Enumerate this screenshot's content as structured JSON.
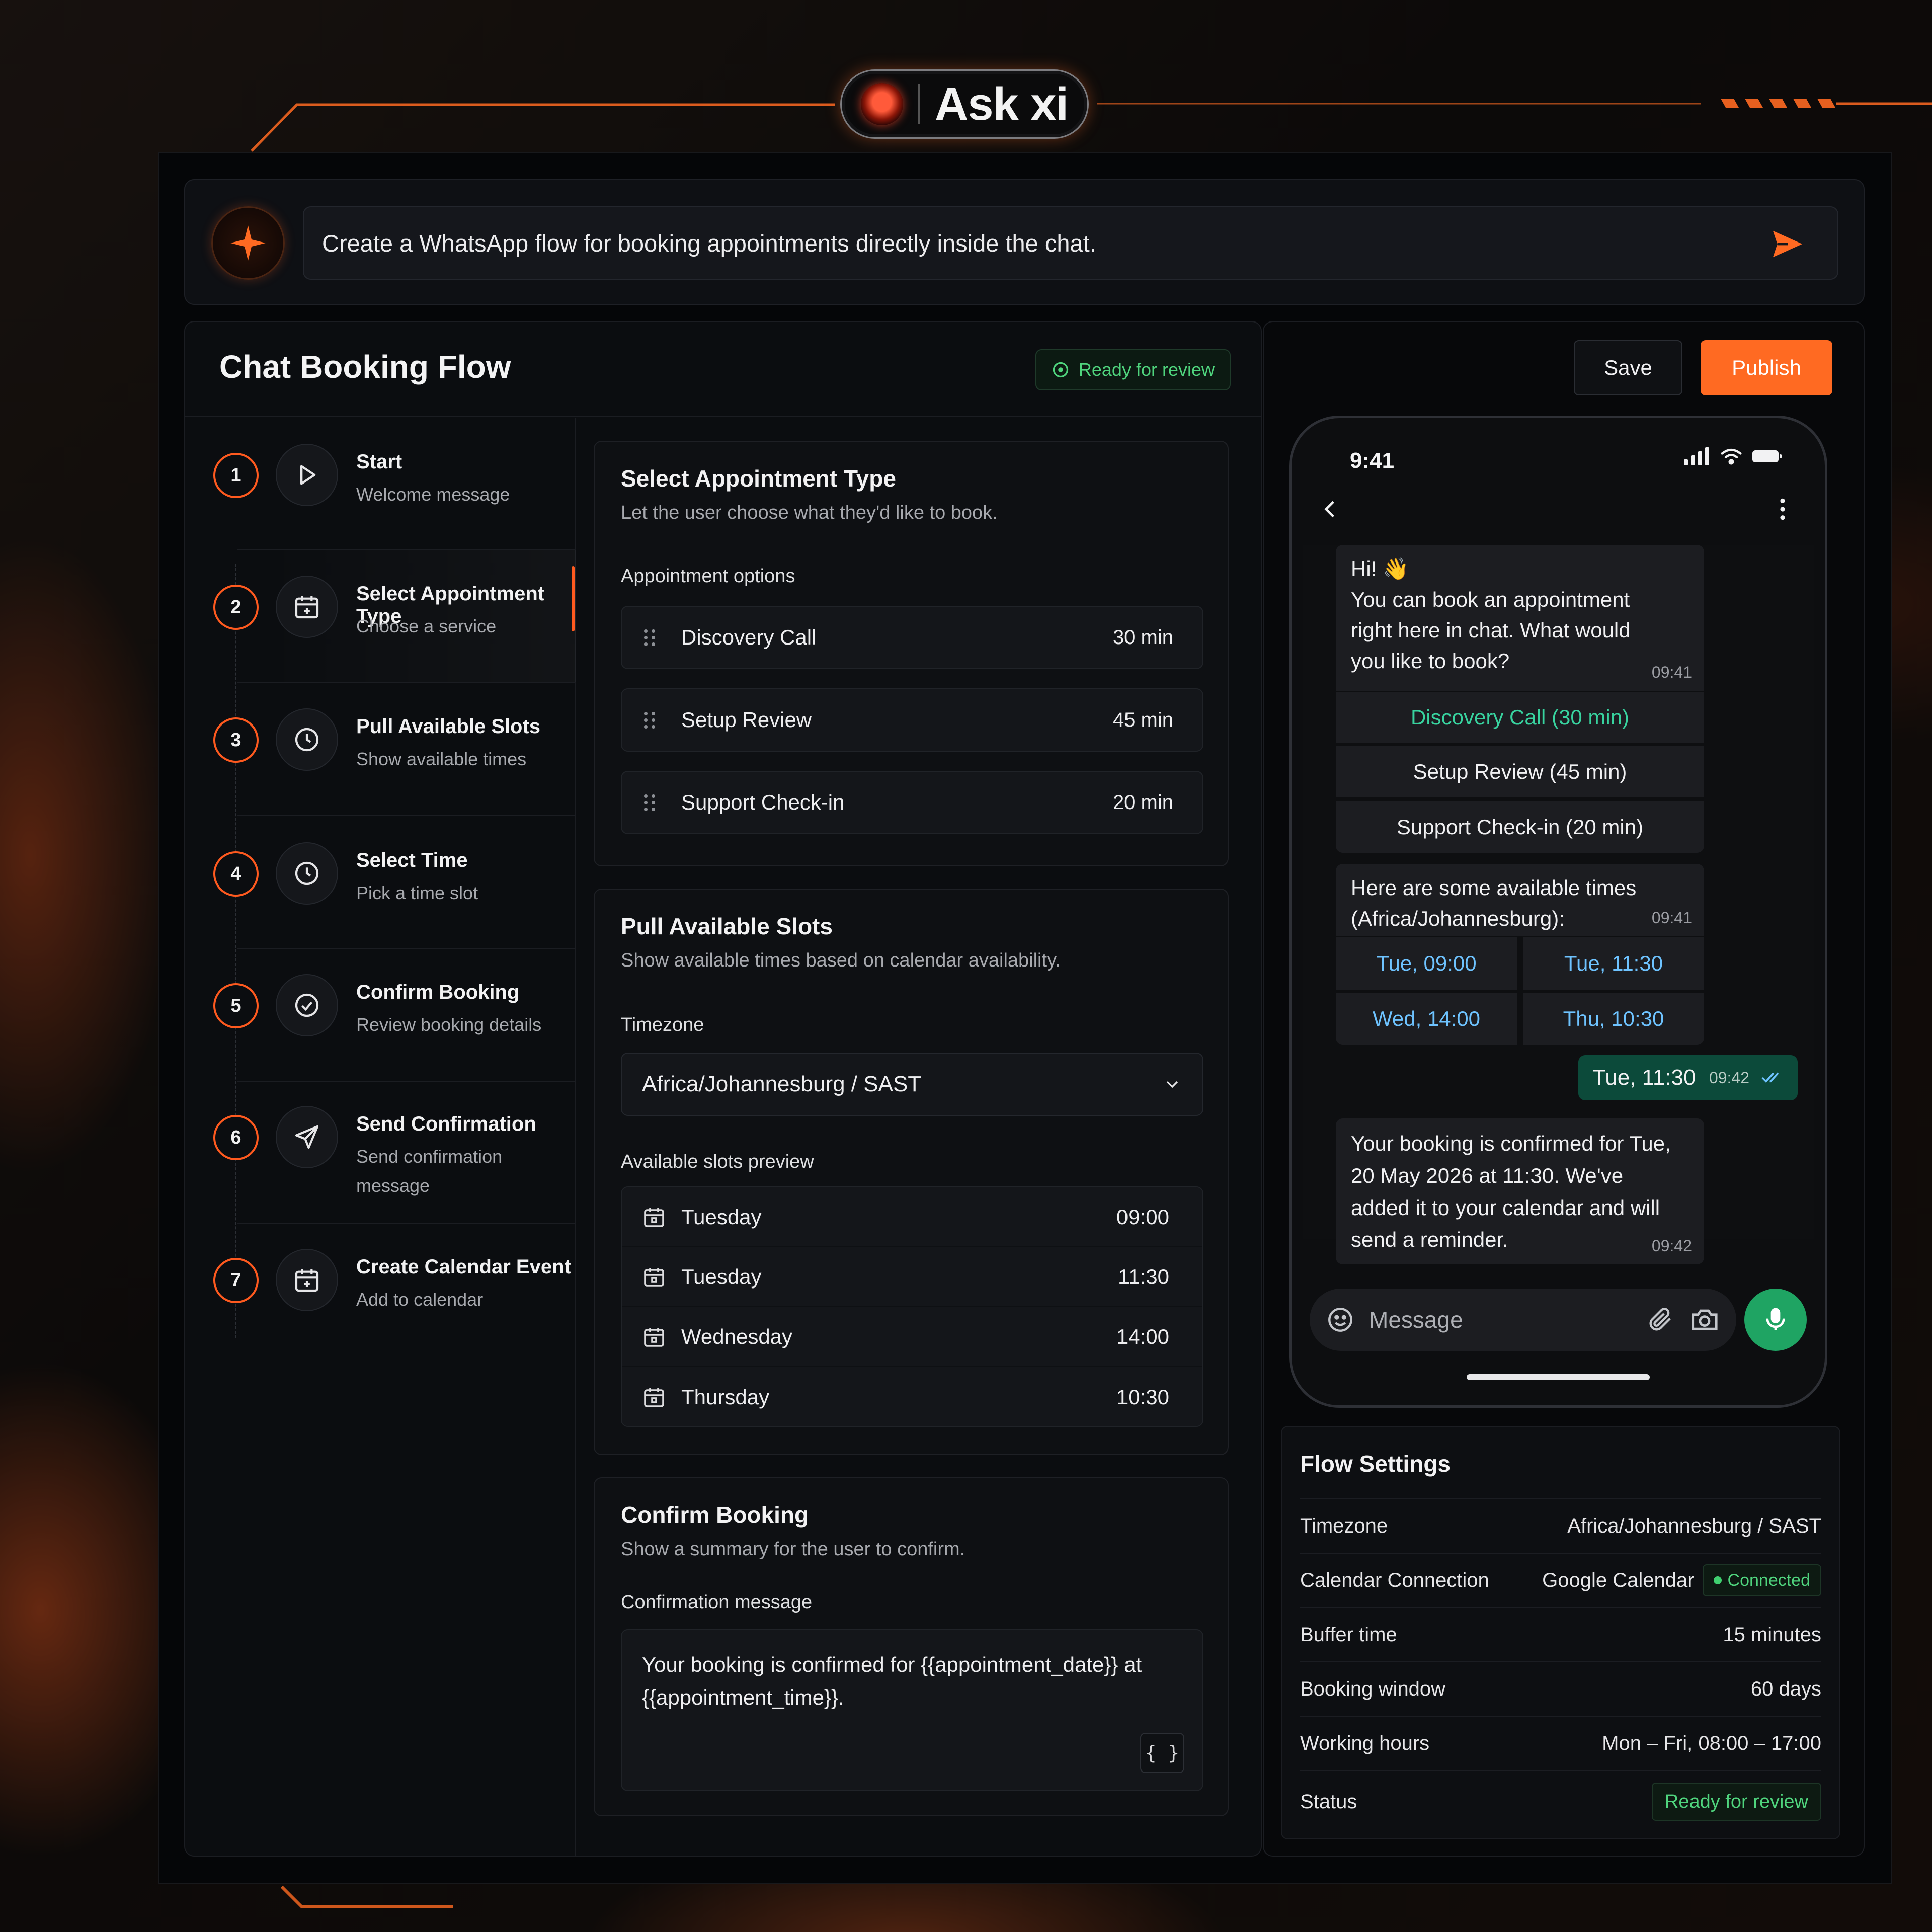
{
  "brand": {
    "name": "Ask xi"
  },
  "prompt": {
    "text": "Create a WhatsApp flow for booking appointments directly inside the chat."
  },
  "flow": {
    "title": "Chat Booking Flow",
    "badge": "Ready for review",
    "steps": [
      {
        "num": "1",
        "title": "Start",
        "desc": "Welcome message",
        "icon": "play-icon"
      },
      {
        "num": "2",
        "title": "Select Appointment Type",
        "desc": "Choose a service",
        "icon": "calendar-plus-icon"
      },
      {
        "num": "3",
        "title": "Pull Available Slots",
        "desc": "Show available times",
        "icon": "clock-icon"
      },
      {
        "num": "4",
        "title": "Select Time",
        "desc": "Pick a time slot",
        "icon": "clock-icon"
      },
      {
        "num": "5",
        "title": "Confirm Booking",
        "desc": "Review booking details",
        "icon": "check-circle-icon"
      },
      {
        "num": "6",
        "title": "Send Confirmation",
        "desc": "Send confirmation message",
        "icon": "send-icon"
      },
      {
        "num": "7",
        "title": "Create Calendar Event",
        "desc": "Add to calendar",
        "icon": "calendar-plus-icon"
      }
    ]
  },
  "appointment_type": {
    "title": "Select Appointment Type",
    "desc": "Let the user choose what they'd like to book.",
    "options_label": "Appointment options",
    "options": [
      {
        "name": "Discovery Call",
        "duration": "30 min"
      },
      {
        "name": "Setup Review",
        "duration": "45 min"
      },
      {
        "name": "Support Check-in",
        "duration": "20 min"
      }
    ]
  },
  "slots_card": {
    "title": "Pull Available Slots",
    "desc": "Show available times based on calendar availability.",
    "tz_label": "Timezone",
    "tz_value": "Africa/Johannesburg / SAST",
    "preview_label": "Available slots preview",
    "slots": [
      {
        "day": "Tuesday",
        "time": "09:00"
      },
      {
        "day": "Tuesday",
        "time": "11:30"
      },
      {
        "day": "Wednesday",
        "time": "14:00"
      },
      {
        "day": "Thursday",
        "time": "10:30"
      }
    ]
  },
  "confirm_card": {
    "title": "Confirm Booking",
    "desc": "Show a summary for the user to confirm.",
    "msg_label": "Confirmation message",
    "msg_value": "Your booking is confirmed for {{appointment_date}} at {{appointment_time}}.",
    "brace": "{ }"
  },
  "actions": {
    "save": "Save",
    "publish": "Publish"
  },
  "phone": {
    "time": "9:41",
    "greeting": "Hi! 👋",
    "intro": "You can book an appointment right here in chat. What would you like to book?",
    "intro_time": "09:41",
    "quick_replies": [
      "Discovery Call (30 min)",
      "Setup Review (45 min)",
      "Support Check-in (20 min)"
    ],
    "slots_msg": "Here are some available times (Africa/Johannesburg):",
    "slots_time": "09:41",
    "time_buttons": [
      "Tue, 09:00",
      "Tue, 11:30",
      "Wed, 14:00",
      "Thu, 10:30"
    ],
    "user_reply": "Tue, 11:30",
    "user_reply_time": "09:42",
    "confirm_msg": "Your booking is confirmed for Tue, 20 May 2026 at 11:30. We've added it to your calendar and will send a reminder.",
    "confirm_time": "09:42",
    "composer_placeholder": "Message"
  },
  "settings": {
    "title": "Flow Settings",
    "rows": [
      {
        "key": "Timezone",
        "value": "Africa/Johannesburg / SAST"
      },
      {
        "key": "Calendar Connection",
        "value": "Google Calendar",
        "pill": "Connected"
      },
      {
        "key": "Buffer time",
        "value": "15 minutes"
      },
      {
        "key": "Booking window",
        "value": "60 days"
      },
      {
        "key": "Working hours",
        "value": "Mon – Fri, 08:00 – 17:00"
      },
      {
        "key": "Status",
        "value": "Ready for review"
      }
    ]
  },
  "colors": {
    "accent": "#ff6a22",
    "success": "#4fd47d",
    "whatsapp_green": "#1fa463",
    "link_blue": "#6ec3ff"
  }
}
